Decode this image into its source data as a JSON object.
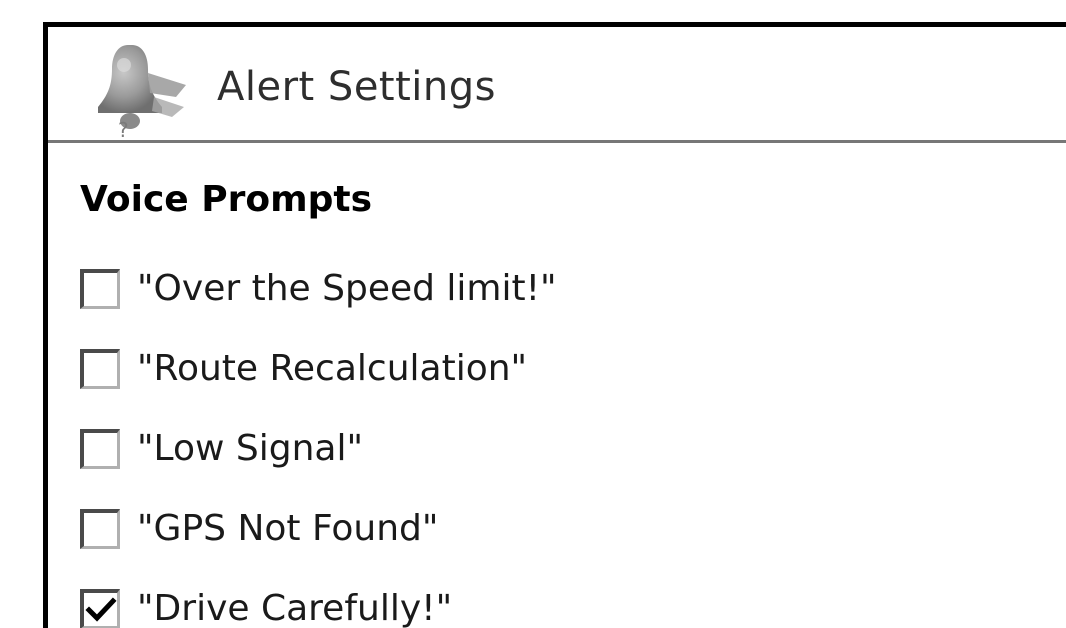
{
  "window": {
    "title": "Alert Settings",
    "title_icon": "alert-bell-icon"
  },
  "voice_prompts": {
    "heading": "Voice Prompts",
    "options": [
      {
        "label": "\"Over the Speed limit!\"",
        "checked": false
      },
      {
        "label": "\"Route Recalculation\"",
        "checked": false
      },
      {
        "label": "\"Low Signal\"",
        "checked": false
      },
      {
        "label": "\"GPS Not Found\"",
        "checked": false
      },
      {
        "label": "\"Drive Carefully!\"",
        "checked": true
      }
    ]
  },
  "colors": {
    "border": "#000000",
    "divider": "#777777",
    "text": "#1a1a1a",
    "icon_gray": "#9a9a9a"
  }
}
